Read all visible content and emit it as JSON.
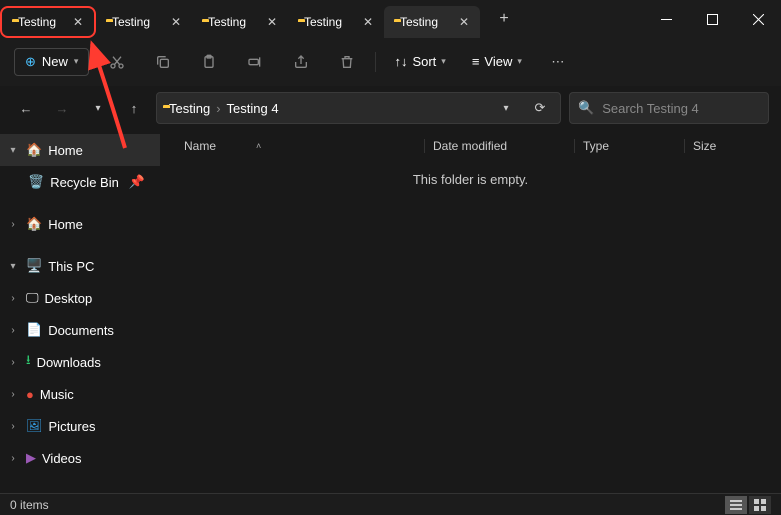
{
  "tabs": [
    {
      "label": "Testing",
      "active": false,
      "highlight": true
    },
    {
      "label": "Testing",
      "active": false,
      "highlight": false
    },
    {
      "label": "Testing",
      "active": false,
      "highlight": false
    },
    {
      "label": "Testing",
      "active": false,
      "highlight": false
    },
    {
      "label": "Testing",
      "active": true,
      "highlight": false
    }
  ],
  "toolbar": {
    "new_label": "New",
    "sort_label": "Sort",
    "view_label": "View"
  },
  "breadcrumb": {
    "segments": [
      "Testing",
      "Testing 4"
    ]
  },
  "search": {
    "placeholder": "Search Testing 4"
  },
  "sidebar": {
    "home": "Home",
    "recycle": "Recycle Bin",
    "home2": "Home",
    "thispc": "This PC",
    "desktop": "Desktop",
    "documents": "Documents",
    "downloads": "Downloads",
    "music": "Music",
    "pictures": "Pictures",
    "videos": "Videos"
  },
  "columns": {
    "name": "Name",
    "date": "Date modified",
    "type": "Type",
    "size": "Size"
  },
  "empty_text": "This folder is empty.",
  "status_text": "0 items"
}
